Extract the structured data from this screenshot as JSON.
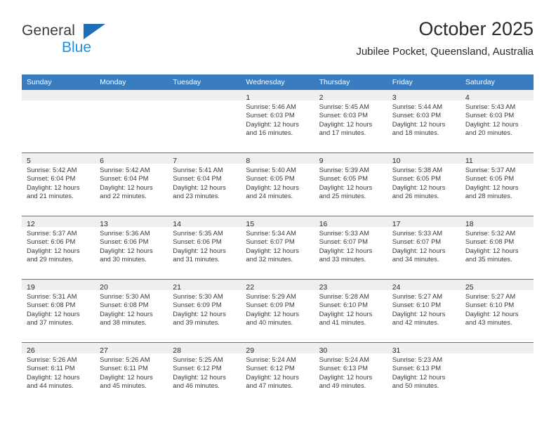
{
  "brand": {
    "logo_line1": "General",
    "logo_line2": "Blue",
    "logo_triangle_color": "#1e6fb8",
    "logo_blue_color": "#1f8fe0"
  },
  "header": {
    "title": "October 2025",
    "subtitle": "Jubilee Pocket, Queensland, Australia"
  },
  "theme": {
    "header_blue": "#3a7cc0",
    "daynum_band": "#efefef",
    "text": "#2b2b2b"
  },
  "calendar": {
    "weekday_headers": [
      "Sunday",
      "Monday",
      "Tuesday",
      "Wednesday",
      "Thursday",
      "Friday",
      "Saturday"
    ],
    "weeks": [
      [
        {
          "day": "",
          "lines": []
        },
        {
          "day": "",
          "lines": []
        },
        {
          "day": "",
          "lines": []
        },
        {
          "day": "1",
          "lines": [
            "Sunrise: 5:46 AM",
            "Sunset: 6:03 PM",
            "Daylight: 12 hours",
            "and 16 minutes."
          ]
        },
        {
          "day": "2",
          "lines": [
            "Sunrise: 5:45 AM",
            "Sunset: 6:03 PM",
            "Daylight: 12 hours",
            "and 17 minutes."
          ]
        },
        {
          "day": "3",
          "lines": [
            "Sunrise: 5:44 AM",
            "Sunset: 6:03 PM",
            "Daylight: 12 hours",
            "and 18 minutes."
          ]
        },
        {
          "day": "4",
          "lines": [
            "Sunrise: 5:43 AM",
            "Sunset: 6:03 PM",
            "Daylight: 12 hours",
            "and 20 minutes."
          ]
        }
      ],
      [
        {
          "day": "5",
          "lines": [
            "Sunrise: 5:42 AM",
            "Sunset: 6:04 PM",
            "Daylight: 12 hours",
            "and 21 minutes."
          ]
        },
        {
          "day": "6",
          "lines": [
            "Sunrise: 5:42 AM",
            "Sunset: 6:04 PM",
            "Daylight: 12 hours",
            "and 22 minutes."
          ]
        },
        {
          "day": "7",
          "lines": [
            "Sunrise: 5:41 AM",
            "Sunset: 6:04 PM",
            "Daylight: 12 hours",
            "and 23 minutes."
          ]
        },
        {
          "day": "8",
          "lines": [
            "Sunrise: 5:40 AM",
            "Sunset: 6:05 PM",
            "Daylight: 12 hours",
            "and 24 minutes."
          ]
        },
        {
          "day": "9",
          "lines": [
            "Sunrise: 5:39 AM",
            "Sunset: 6:05 PM",
            "Daylight: 12 hours",
            "and 25 minutes."
          ]
        },
        {
          "day": "10",
          "lines": [
            "Sunrise: 5:38 AM",
            "Sunset: 6:05 PM",
            "Daylight: 12 hours",
            "and 26 minutes."
          ]
        },
        {
          "day": "11",
          "lines": [
            "Sunrise: 5:37 AM",
            "Sunset: 6:05 PM",
            "Daylight: 12 hours",
            "and 28 minutes."
          ]
        }
      ],
      [
        {
          "day": "12",
          "lines": [
            "Sunrise: 5:37 AM",
            "Sunset: 6:06 PM",
            "Daylight: 12 hours",
            "and 29 minutes."
          ]
        },
        {
          "day": "13",
          "lines": [
            "Sunrise: 5:36 AM",
            "Sunset: 6:06 PM",
            "Daylight: 12 hours",
            "and 30 minutes."
          ]
        },
        {
          "day": "14",
          "lines": [
            "Sunrise: 5:35 AM",
            "Sunset: 6:06 PM",
            "Daylight: 12 hours",
            "and 31 minutes."
          ]
        },
        {
          "day": "15",
          "lines": [
            "Sunrise: 5:34 AM",
            "Sunset: 6:07 PM",
            "Daylight: 12 hours",
            "and 32 minutes."
          ]
        },
        {
          "day": "16",
          "lines": [
            "Sunrise: 5:33 AM",
            "Sunset: 6:07 PM",
            "Daylight: 12 hours",
            "and 33 minutes."
          ]
        },
        {
          "day": "17",
          "lines": [
            "Sunrise: 5:33 AM",
            "Sunset: 6:07 PM",
            "Daylight: 12 hours",
            "and 34 minutes."
          ]
        },
        {
          "day": "18",
          "lines": [
            "Sunrise: 5:32 AM",
            "Sunset: 6:08 PM",
            "Daylight: 12 hours",
            "and 35 minutes."
          ]
        }
      ],
      [
        {
          "day": "19",
          "lines": [
            "Sunrise: 5:31 AM",
            "Sunset: 6:08 PM",
            "Daylight: 12 hours",
            "and 37 minutes."
          ]
        },
        {
          "day": "20",
          "lines": [
            "Sunrise: 5:30 AM",
            "Sunset: 6:08 PM",
            "Daylight: 12 hours",
            "and 38 minutes."
          ]
        },
        {
          "day": "21",
          "lines": [
            "Sunrise: 5:30 AM",
            "Sunset: 6:09 PM",
            "Daylight: 12 hours",
            "and 39 minutes."
          ]
        },
        {
          "day": "22",
          "lines": [
            "Sunrise: 5:29 AM",
            "Sunset: 6:09 PM",
            "Daylight: 12 hours",
            "and 40 minutes."
          ]
        },
        {
          "day": "23",
          "lines": [
            "Sunrise: 5:28 AM",
            "Sunset: 6:10 PM",
            "Daylight: 12 hours",
            "and 41 minutes."
          ]
        },
        {
          "day": "24",
          "lines": [
            "Sunrise: 5:27 AM",
            "Sunset: 6:10 PM",
            "Daylight: 12 hours",
            "and 42 minutes."
          ]
        },
        {
          "day": "25",
          "lines": [
            "Sunrise: 5:27 AM",
            "Sunset: 6:10 PM",
            "Daylight: 12 hours",
            "and 43 minutes."
          ]
        }
      ],
      [
        {
          "day": "26",
          "lines": [
            "Sunrise: 5:26 AM",
            "Sunset: 6:11 PM",
            "Daylight: 12 hours",
            "and 44 minutes."
          ]
        },
        {
          "day": "27",
          "lines": [
            "Sunrise: 5:26 AM",
            "Sunset: 6:11 PM",
            "Daylight: 12 hours",
            "and 45 minutes."
          ]
        },
        {
          "day": "28",
          "lines": [
            "Sunrise: 5:25 AM",
            "Sunset: 6:12 PM",
            "Daylight: 12 hours",
            "and 46 minutes."
          ]
        },
        {
          "day": "29",
          "lines": [
            "Sunrise: 5:24 AM",
            "Sunset: 6:12 PM",
            "Daylight: 12 hours",
            "and 47 minutes."
          ]
        },
        {
          "day": "30",
          "lines": [
            "Sunrise: 5:24 AM",
            "Sunset: 6:13 PM",
            "Daylight: 12 hours",
            "and 49 minutes."
          ]
        },
        {
          "day": "31",
          "lines": [
            "Sunrise: 5:23 AM",
            "Sunset: 6:13 PM",
            "Daylight: 12 hours",
            "and 50 minutes."
          ]
        },
        {
          "day": "",
          "lines": []
        }
      ]
    ]
  }
}
